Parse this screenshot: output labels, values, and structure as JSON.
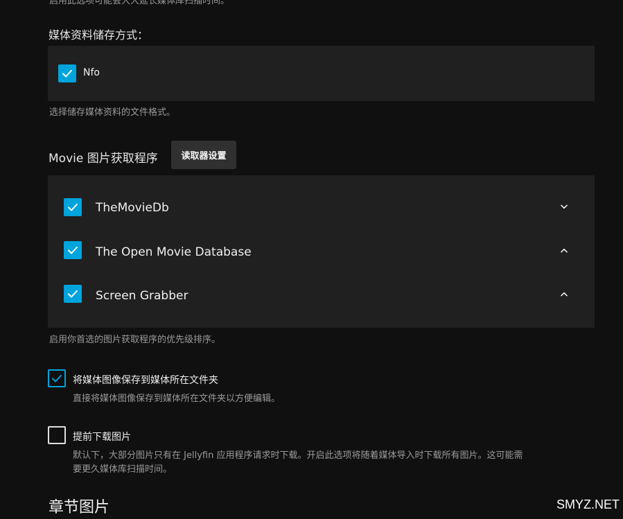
{
  "top_cut_text": "启用此选项可能会大大延长媒体库扫描时间。",
  "metadata_savers": {
    "label": "媒体资料储存方式：",
    "items": [
      {
        "label": "Nfo",
        "checked": true
      }
    ],
    "help": "选择储存媒体资料的文件格式。"
  },
  "image_fetchers": {
    "label": "Movie 图片获取程序",
    "settings_button": "读取器设置",
    "items": [
      {
        "label": "TheMovieDb",
        "checked": true,
        "chevron": "down"
      },
      {
        "label": "The Open Movie Database",
        "checked": true,
        "chevron": "up"
      },
      {
        "label": "Screen Grabber",
        "checked": true,
        "chevron": "up"
      }
    ],
    "help": "启用你首选的图片获取程序的优先级排序。"
  },
  "save_local": {
    "label": "将媒体图像保存到媒体所在文件夹",
    "checked": true,
    "help": "直接将媒体图像保存到媒体所在文件夹以方便编辑。"
  },
  "download_images": {
    "label": "提前下载图片",
    "checked": false,
    "help_line1": "默认下，大部分图片只有在 Jellyfin 应用程序请求时下载。开启此选项将随着媒体导入时下载所有图片。这可能需",
    "help_line2": "要更久媒体库扫描时间。"
  },
  "chapter_heading": "章节图片",
  "watermark": "SMYZ.NET",
  "colors": {
    "accent": "#00a4dc",
    "background": "#101010",
    "panel": "#202020"
  }
}
